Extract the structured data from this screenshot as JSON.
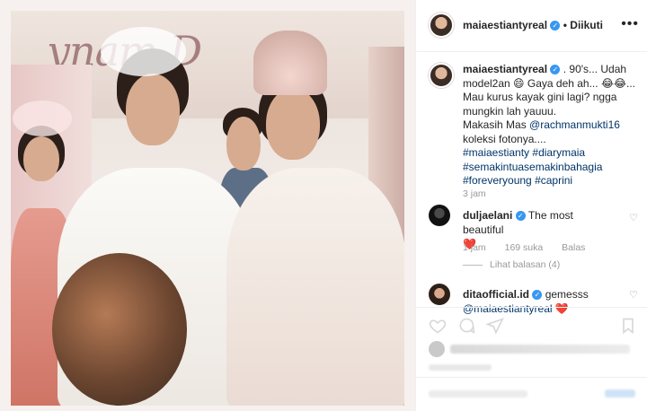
{
  "post_header": {
    "username": "maiaestiantyreal",
    "separator": "•",
    "follow_status": "Diikuti",
    "more_icon": "more-horizontal-icon"
  },
  "photo": {
    "banner_text": "ynam   D"
  },
  "caption": {
    "username": "maiaestiantyreal",
    "line1": ". 90's... Udah model2an 😄 Gaya deh ah... 😂😂...",
    "line2": "Mau kurus kayak gini lagi? ngga mungkin lah yauuu.",
    "line3_prefix": "Makasih Mas ",
    "mention": "@rachmanmukti16",
    "line4": "koleksi fotonya....",
    "hashtags": [
      "#maiaestianty",
      "#diarymaia",
      "#semakintuasemakinbahagia",
      "#foreveryoung",
      "#caprini"
    ],
    "time": "3 jam"
  },
  "comments": [
    {
      "username": "duljaelani",
      "text": "The most beautiful",
      "emoji": "❤️",
      "time": "1 jam",
      "likes": "169 suka",
      "reply": "Balas",
      "view_replies": "Lihat balasan (4)"
    },
    {
      "username": "ditaofficial.id",
      "text": "gemesss",
      "mention": "@maiaestiantyreal",
      "emoji": "❤️"
    }
  ],
  "colors": {
    "link": "#003569",
    "verified": "#3897f0",
    "heart": "#ed4956",
    "meta": "#999999"
  }
}
